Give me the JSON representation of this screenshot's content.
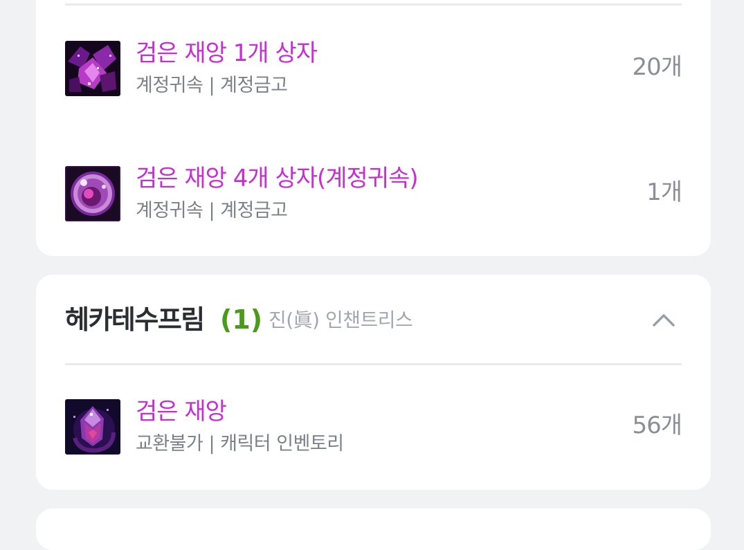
{
  "colors": {
    "page_bg": "#f1f2f4",
    "card_bg": "#ffffff",
    "item_name": "#c62fd2",
    "item_sub": "#7c8089",
    "count": "#8a8e97",
    "char_count": "#4c9a1a",
    "server": "#a3a6ad"
  },
  "group1": {
    "items": [
      {
        "name": "검은 재앙 1개 상자",
        "sub": "계정귀속 | 계정금고",
        "count": "20개",
        "icon": "purple-crystal-box-icon"
      },
      {
        "name": "검은 재앙 4개 상자(계정귀속)",
        "sub": "계정귀속 | 계정금고",
        "count": "1개",
        "icon": "purple-orb-box-icon"
      }
    ]
  },
  "group2": {
    "character": "헤카테수프림",
    "count": "(1)",
    "server": "진(眞) 인챈트리스",
    "collapse_icon": "chevron-up-icon",
    "items": [
      {
        "name": "검은 재앙",
        "sub": "교환불가 | 캐릭터 인벤토리",
        "count": "56개",
        "icon": "purple-gem-icon"
      }
    ]
  }
}
